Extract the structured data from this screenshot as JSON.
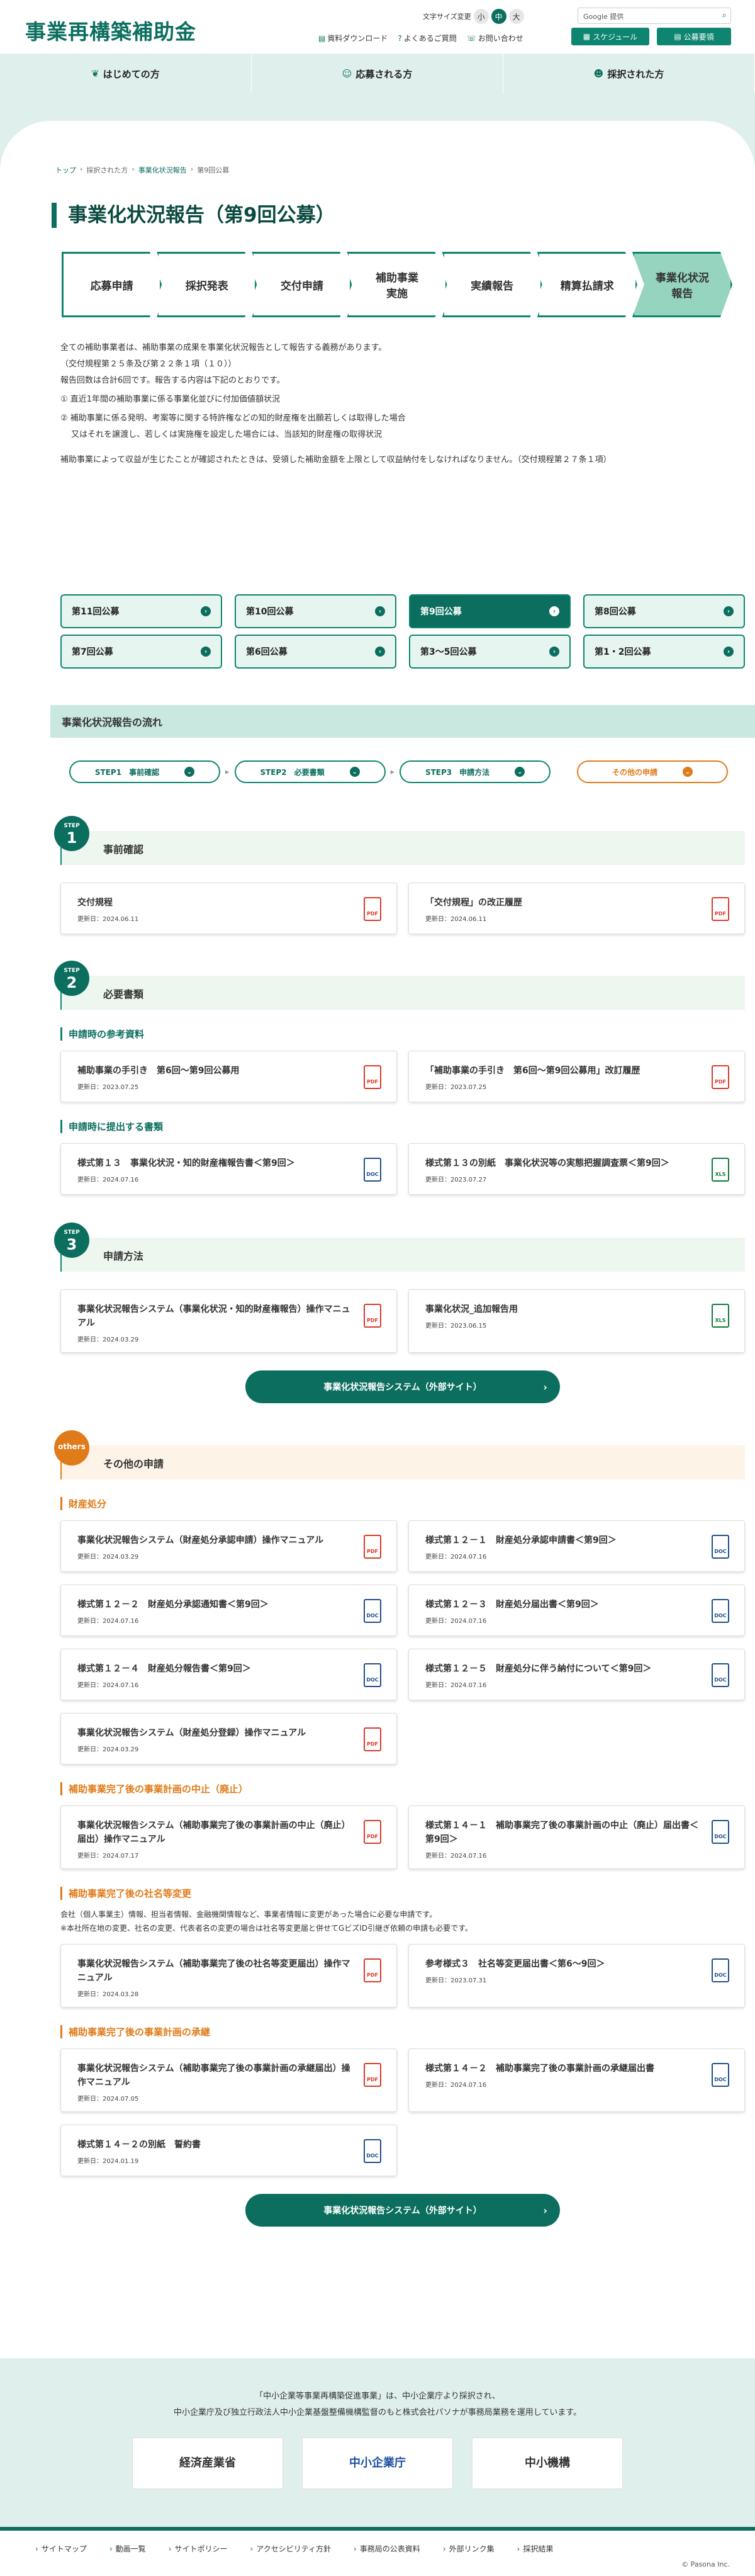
{
  "header": {
    "logo": "事業再構築補助金",
    "font_size_label": "文字サイズ変更",
    "sizes": [
      "小",
      "中",
      "大"
    ],
    "search_placeholder": "Google 提供",
    "util": [
      "資料ダウンロード",
      "よくあるご質問",
      "お問い合わせ"
    ],
    "btn_schedule": "スケジュール",
    "btn_koubo": "公募要領"
  },
  "gnav": [
    "はじめての方",
    "応募される方",
    "採択された方"
  ],
  "breadcrumb": [
    "トップ",
    "採択された方",
    "事業化状況報告",
    "第9回公募"
  ],
  "page_title": "事業化状況報告（第9回公募）",
  "steps": [
    "応募申請",
    "採択発表",
    "交付申請",
    "補助事業\n実施",
    "実績報告",
    "精算払請求",
    "事業化状況\n報告"
  ],
  "intro": [
    "全ての補助事業者は、補助事業の成果を事業化状況報告として報告する義務があります。",
    "（交付規程第２５条及び第２２条１項（１０））",
    "報告回数は合計6回です。報告する内容は下記のとおりです。",
    "① 直近1年間の補助事業に係る事業化並びに付加価値額状況",
    "② 補助事業に係る発明、考案等に関する特許権などの知的財産権を出願若しくは取得した場合",
    "　 又はそれを譲渡し、若しくは実施権を設定した場合には、当該知的財産権の取得状況",
    "補助事業によって収益が生じたことが確認されたときは、受領した補助金額を上限として収益納付をしなければなりません。（交付規程第２７条１項）"
  ],
  "kobo_tabs": [
    "第11回公募",
    "第10回公募",
    "第9回公募",
    "第8回公募",
    "第7回公募",
    "第6回公募",
    "第3～5回公募",
    "第1・2回公募"
  ],
  "flow_heading": "事業化状況報告の流れ",
  "flow": [
    "STEP1　事前確認",
    "STEP2　必要書類",
    "STEP3　申請方法",
    "その他の申請"
  ],
  "s1": {
    "step": "STEP",
    "num": "1",
    "title": "事前確認",
    "cards": [
      {
        "t": "交付規程",
        "d": "更新日：2024.06.11",
        "f": "PDF"
      },
      {
        "t": "「交付規程」の改正履歴",
        "d": "更新日：2024.06.11",
        "f": "PDF"
      }
    ]
  },
  "s2": {
    "step": "STEP",
    "num": "2",
    "title": "必要書類",
    "sub1": "申請時の参考資料",
    "cards1": [
      {
        "t": "補助事業の手引き　第6回～第9回公募用",
        "d": "更新日：2023.07.25",
        "f": "PDF"
      },
      {
        "t": "「補助事業の手引き　第6回～第9回公募用」改訂履歴",
        "d": "更新日：2023.07.25",
        "f": "PDF"
      }
    ],
    "sub2": "申請時に提出する書類",
    "cards2": [
      {
        "t": "様式第１３　事業化状況・知的財産権報告書＜第9回＞",
        "d": "更新日：2024.07.16",
        "f": "DOC"
      },
      {
        "t": "様式第１３の別紙　事業化状況等の実態把握調査票＜第9回＞",
        "d": "更新日：2023.07.27",
        "f": "XLS"
      }
    ]
  },
  "s3": {
    "step": "STEP",
    "num": "3",
    "title": "申請方法",
    "cards": [
      {
        "t": "事業化状況報告システム（事業化状況・知的財産権報告）操作マニュアル",
        "d": "更新日：2024.03.29",
        "f": "PDF"
      },
      {
        "t": "事業化状況_追加報告用",
        "d": "更新日：2023.06.15",
        "f": "XLS"
      }
    ],
    "btn": "事業化状況報告システム（外部サイト）"
  },
  "s4": {
    "badge": "others",
    "title": "その他の申請",
    "sub1": "財産処分",
    "cards1": [
      {
        "t": "事業化状況報告システム（財産処分承認申請）操作マニュアル",
        "d": "更新日：2024.03.29",
        "f": "PDF"
      },
      {
        "t": "様式第１２－１　財産処分承認申請書＜第9回＞",
        "d": "更新日：2024.07.16",
        "f": "DOC"
      },
      {
        "t": "様式第１２－２　財産処分承認通知書＜第9回＞",
        "d": "更新日：2024.07.16",
        "f": "DOC"
      },
      {
        "t": "様式第１２－３　財産処分届出書＜第9回＞",
        "d": "更新日：2024.07.16",
        "f": "DOC"
      },
      {
        "t": "様式第１２－４　財産処分報告書＜第9回＞",
        "d": "更新日：2024.07.16",
        "f": "DOC"
      },
      {
        "t": "様式第１２－５　財産処分に伴う納付について＜第9回＞",
        "d": "更新日：2024.07.16",
        "f": "DOC"
      },
      {
        "t": "事業化状況報告システム（財産処分登録）操作マニュアル",
        "d": "更新日：2024.03.29",
        "f": "PDF"
      }
    ],
    "sub2": "補助事業完了後の事業計画の中止（廃止）",
    "cards2": [
      {
        "t": "事業化状況報告システム（補助事業完了後の事業計画の中止（廃止）届出）操作マニュアル",
        "d": "更新日：2024.07.17",
        "f": "PDF"
      },
      {
        "t": "様式第１４－１　補助事業完了後の事業計画の中止（廃止）届出書＜第9回＞",
        "d": "更新日：2024.07.16",
        "f": "DOC"
      }
    ],
    "sub3": "補助事業完了後の社名等変更",
    "note": [
      "会社（個人事業主）情報、担当者情報、金融機関情報など、事業者情報に変更があった場合に必要な申請です。",
      "※本社所在地の変更、社名の変更、代表者名の変更の場合は社名等変更届と併せてGビズID引継ぎ依頼の申請も必要です。"
    ],
    "cards3": [
      {
        "t": "事業化状況報告システム（補助事業完了後の社名等変更届出）操作マニュアル",
        "d": "更新日：2024.03.28",
        "f": "PDF"
      },
      {
        "t": "参考様式３　社名等変更届出書＜第6～9回＞",
        "d": "更新日：2023.07.31",
        "f": "DOC"
      }
    ],
    "sub4": "補助事業完了後の事業計画の承継",
    "cards4": [
      {
        "t": "事業化状況報告システム（補助事業完了後の事業計画の承継届出）操作マニュアル",
        "d": "更新日：2024.07.05",
        "f": "PDF"
      },
      {
        "t": "様式第１４－２　補助事業完了後の事業計画の承継届出書",
        "d": "更新日：2024.07.16",
        "f": "DOC"
      },
      {
        "t": "様式第１４－２の別紙　誓約書",
        "d": "更新日：2024.01.19",
        "f": "DOC"
      }
    ],
    "btn": "事業化状況報告システム（外部サイト）"
  },
  "footer": {
    "l1": "「中小企業等事業再構築促進事業」は、中小企業庁より採択され、",
    "l2": "中小企業庁及び独立行政法人中小企業基盤整備機構監督のもと株式会社パソナが事務局業務を運用しています。",
    "logos": [
      "経済産業省",
      "中小企業庁",
      "中小機構"
    ],
    "links": [
      "サイトマップ",
      "動画一覧",
      "サイトポリシー",
      "アクセシビリティ方針",
      "事務局の公表資料",
      "外部リンク集",
      "採択結果"
    ],
    "copy": "© Pasona Inc."
  }
}
